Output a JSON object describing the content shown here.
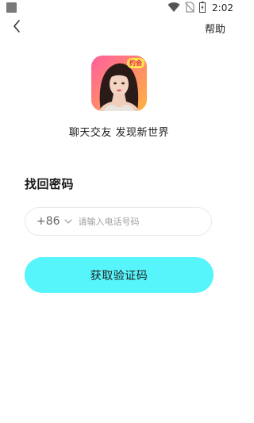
{
  "status_bar": {
    "time": "2:02",
    "icons": [
      "wifi-icon",
      "no-sim-icon",
      "battery-icon"
    ]
  },
  "header": {
    "back_icon": "chevron-left-icon",
    "help_label": "帮助"
  },
  "app": {
    "logo_icon": "app-logo",
    "logo_badge_text": "约会",
    "slogan": "聊天交友 发现新世界"
  },
  "page": {
    "title": "找回密码"
  },
  "phone_field": {
    "country_code": "+86",
    "chevron_icon": "chevron-down-icon",
    "value": "",
    "placeholder": "请输入电话号码"
  },
  "actions": {
    "get_code_label": "获取验证码"
  },
  "colors": {
    "accent": "#55f5fb",
    "background": "#ffffff",
    "input_border": "#e8e8e8",
    "logo_gradient_start": "#ff6aa8",
    "logo_gradient_end": "#ffb340"
  }
}
